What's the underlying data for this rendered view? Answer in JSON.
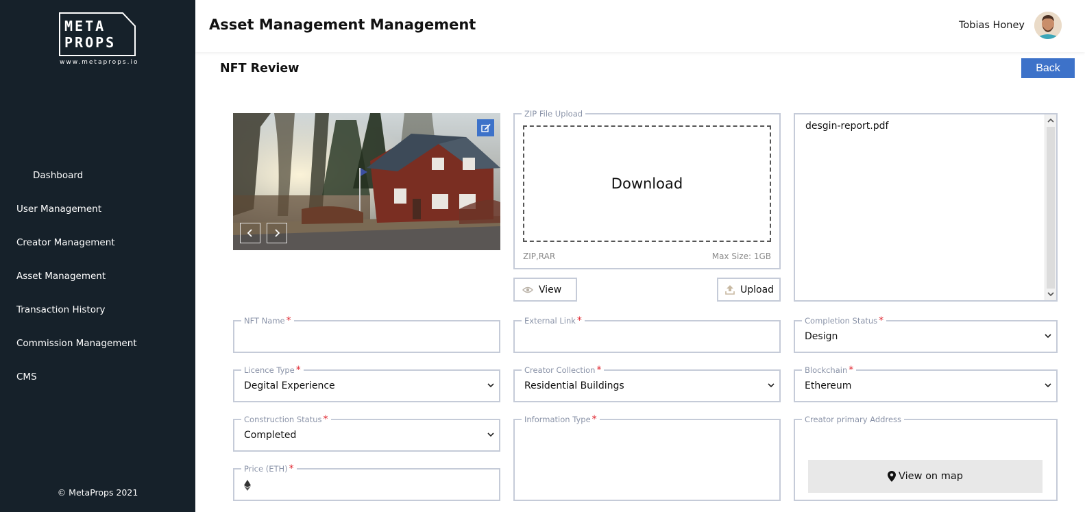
{
  "brand": {
    "logo_line1": "META",
    "logo_line2": "PROPS",
    "url": "www.metaprops.io",
    "copyright": "© MetaProps 2021"
  },
  "sidebar": {
    "items": [
      {
        "label": "Dashboard"
      },
      {
        "label": "User Management"
      },
      {
        "label": "Creator Management"
      },
      {
        "label": "Asset Management"
      },
      {
        "label": "Transaction History"
      },
      {
        "label": "Commission Management"
      },
      {
        "label": "CMS"
      }
    ]
  },
  "header": {
    "title": "Asset Management Management",
    "user_name": "Tobias Honey"
  },
  "main": {
    "section_title": "NFT Review",
    "back_label": "Back"
  },
  "zip_upload": {
    "legend": "ZIP File Upload",
    "drop_label": "Download",
    "formats": "ZIP,RAR",
    "max_size": "Max Size: 1GB",
    "view_label": "View",
    "upload_label": "Upload"
  },
  "files": {
    "items": [
      "desgin-report.pdf"
    ]
  },
  "form": {
    "nft_name": {
      "label": "NFT Name",
      "required": "*",
      "value": ""
    },
    "external_link": {
      "label": "External Link",
      "required": "*",
      "value": ""
    },
    "completion_status": {
      "label": "Completion Status",
      "required": "*",
      "value": "Design"
    },
    "licence_type": {
      "label": "Licence Type",
      "required": "*",
      "value": "Degital Experience"
    },
    "creator_collection": {
      "label": "Creator Collection",
      "required": "*",
      "value": "Residential Buildings"
    },
    "blockchain": {
      "label": "Blockchain",
      "required": "*",
      "value": "Ethereum"
    },
    "construction_status": {
      "label": "Construction Status",
      "required": "*",
      "value": "Completed"
    },
    "information_type": {
      "label": "Information Type",
      "required": "*",
      "value": ""
    },
    "creator_address": {
      "label": "Creator primary Address",
      "map_label": "View on map"
    },
    "price": {
      "label": "Price (ETH)",
      "required": "*",
      "value": ""
    }
  },
  "colors": {
    "sidebar_bg": "#16212a",
    "accent": "#3d72c9",
    "required": "#e0242e",
    "border": "#c5cbd8"
  },
  "icons": [
    "edit-icon",
    "chevron-left-icon",
    "chevron-right-icon",
    "eye-icon",
    "upload-icon",
    "chevron-down-icon",
    "ethereum-icon",
    "map-marker-icon",
    "scroll-up-icon",
    "scroll-down-icon"
  ]
}
